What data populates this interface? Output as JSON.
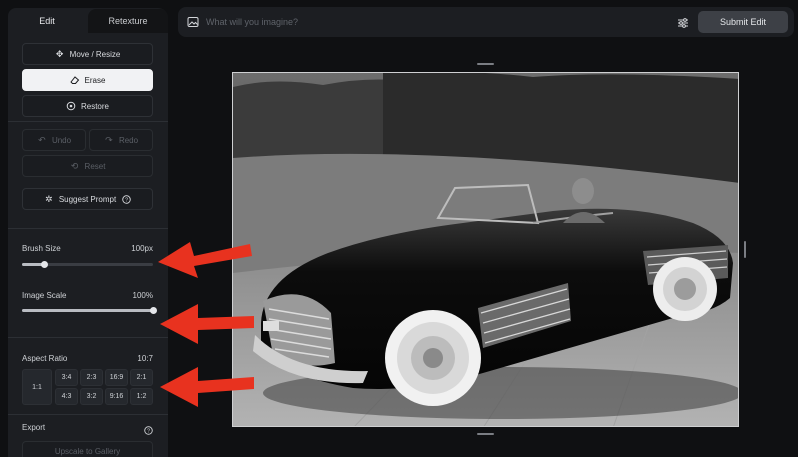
{
  "tabs": {
    "edit": "Edit",
    "retexture": "Retexture"
  },
  "tools": {
    "move_resize": "Move / Resize",
    "erase": "Erase",
    "restore": "Restore",
    "undo": "Undo",
    "redo": "Redo",
    "reset": "Reset",
    "suggest_prompt": "Suggest Prompt"
  },
  "brush_size": {
    "label": "Brush Size",
    "value": "100px",
    "fraction": 0.17
  },
  "image_scale": {
    "label": "Image Scale",
    "value": "100%",
    "fraction": 1.0
  },
  "aspect_ratio": {
    "label": "Aspect Ratio",
    "value": "10:7",
    "options": [
      "1:1",
      "3:4",
      "2:3",
      "16:9",
      "2:1",
      "4:3",
      "3:2",
      "9:16",
      "1:2"
    ]
  },
  "export": {
    "label": "Export",
    "button": "Upscale to Gallery"
  },
  "prompt": {
    "placeholder": "What will you imagine?"
  },
  "submit": "Submit Edit",
  "colors": {
    "accent_arrow": "#e8321f",
    "panel": "#1c1e22",
    "background": "#0f1012"
  }
}
